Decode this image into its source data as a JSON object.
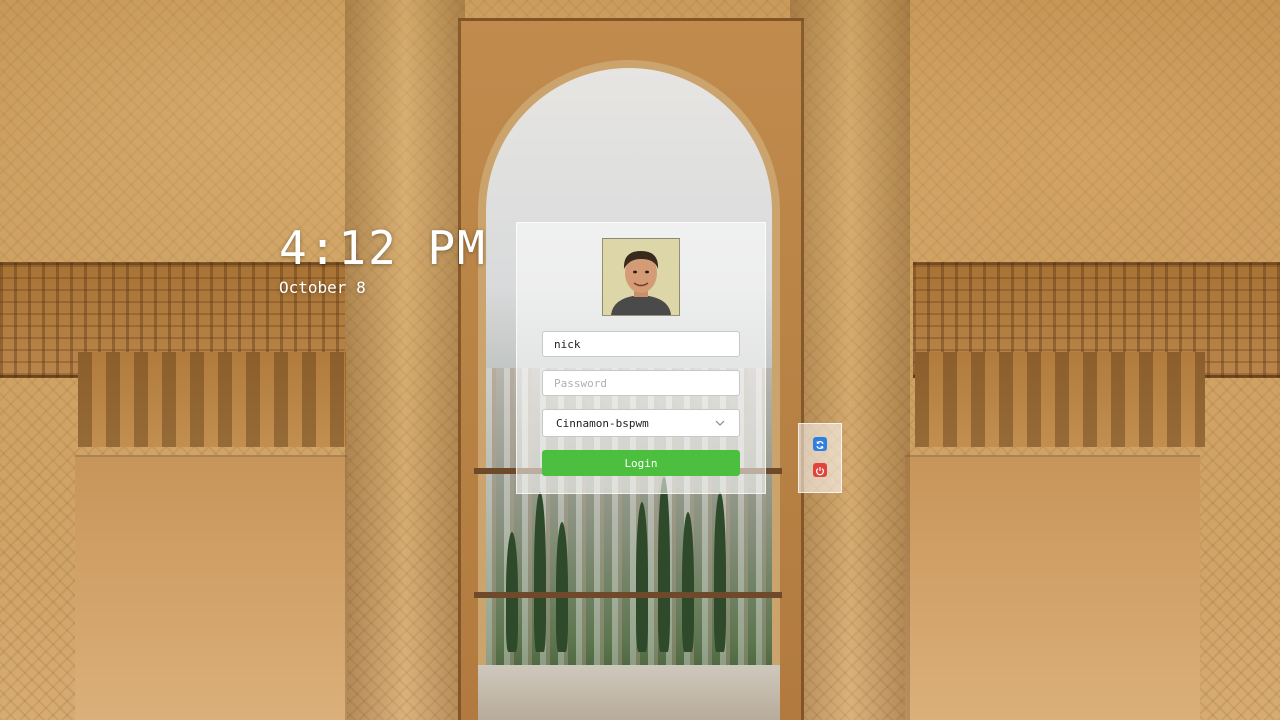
{
  "clock": {
    "time": "4:12 PM",
    "date": "October 8"
  },
  "login": {
    "username_value": "nick",
    "password_placeholder": "Password",
    "session_selected": "Cinnamon-bspwm",
    "login_label": "Login"
  },
  "colors": {
    "login_button": "#4cbf3f",
    "restart_icon": "#2f7fe0",
    "shutdown_icon": "#e0443c"
  },
  "icons": {
    "session_dropdown": "chevron-down-icon",
    "restart": "restart-icon",
    "shutdown": "power-icon"
  }
}
